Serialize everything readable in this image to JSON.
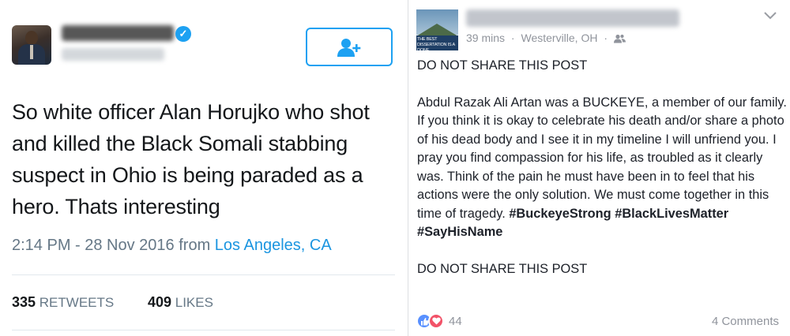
{
  "tweet": {
    "text": "So white officer  Alan Horujko who shot and killed the Black Somali stabbing suspect in Ohio is being paraded as a hero. Thats interesting",
    "timestamp": "2:14 PM - 28 Nov 2016 from ",
    "location": "Los Angeles, CA",
    "retweets_count": "335",
    "retweets_label": "RETWEETS",
    "likes_count": "409",
    "likes_label": "LIKES",
    "colors": {
      "accent": "#1da1f2",
      "link": "#1b95e0",
      "muted": "#657786"
    },
    "icons": {
      "verified": "verified-badge-icon",
      "follow": "add-user-icon"
    }
  },
  "facebook_post": {
    "avatar_text": "THE BEST DISSERTATION IS A DONE DISSERTATION",
    "time": "39 mins",
    "separator": "·",
    "place": "Westerville, OH",
    "warning_top": "DO NOT SHARE THIS POST",
    "body": "Abdul Razak Ali Artan was a BUCKEYE, a member of our family. If you think it is okay to celebrate his death and/or share a photo of his dead body and I see it in my timeline I will unfriend you. I pray you find compassion for his life, as troubled as it clearly was. Think of the pain he must have been in to feel that his actions were the only solution. We must come together in this time of tragedy.",
    "hashtags": [
      "#BuckeyeStrong",
      "#BlackLivesMatter",
      "#SayHisName"
    ],
    "warning_bottom": "DO NOT SHARE THIS POST",
    "reactions_count": "44",
    "comments": "4 Comments",
    "colors": {
      "like": "#5890ff",
      "love": "#f25268",
      "muted": "#90949c"
    },
    "icons": {
      "audience": "friends-icon",
      "menu": "chevron-down-icon",
      "like": "thumbs-up-icon",
      "love": "heart-icon"
    }
  }
}
